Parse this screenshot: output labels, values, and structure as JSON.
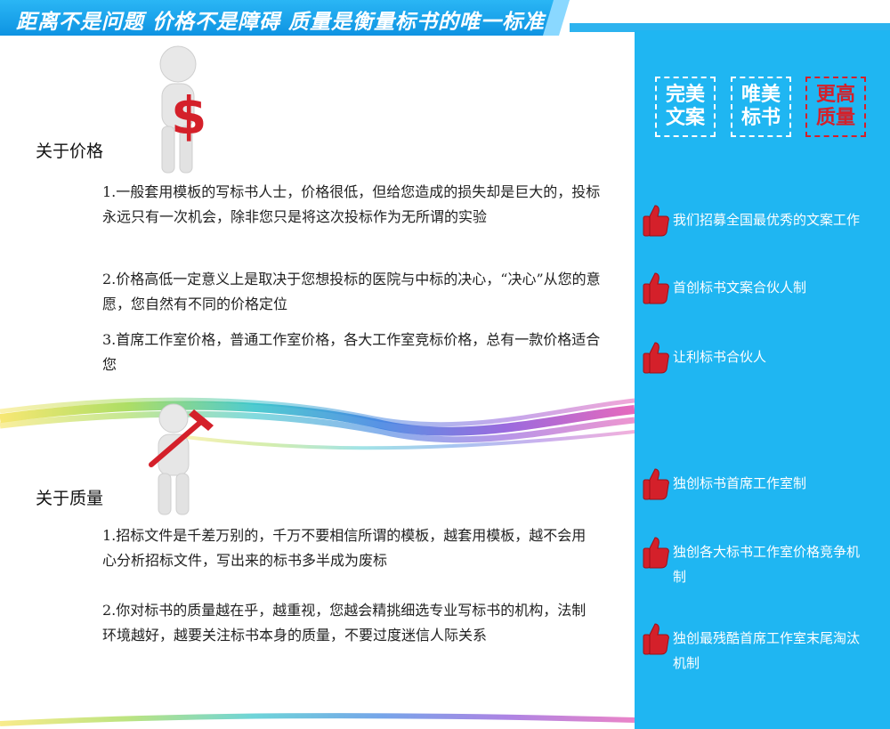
{
  "banner": {
    "title": "距离不是问题 价格不是障碍 质量是衡量标书的唯一标准"
  },
  "slogans": [
    {
      "text": "完美文案",
      "color": "#ffffff"
    },
    {
      "text": "唯美标书",
      "color": "#ffffff"
    },
    {
      "text": "更高质量",
      "color": "#d4202a"
    }
  ],
  "features": [
    {
      "text": "我们招募全国最优秀的文案工作"
    },
    {
      "text": "首创标书文案合伙人制"
    },
    {
      "text": "让利标书合伙人"
    },
    {
      "text": "独创标书首席工作室制"
    },
    {
      "text": "独创各大标书工作室价格竞争机制"
    },
    {
      "text": "独创最残酷首席工作室末尾淘汰机制"
    }
  ],
  "price": {
    "title": "关于价格",
    "items": [
      " 1.一般套用模板的写标书人士，价格很低，但给您造成的损失却是巨大的，投标永远只有一次机会，除非您只是将这次投标作为无所谓的实验",
      "2.价格高低一定意义上是取决于您想投标的医院与中标的决心，“决心”从您的意愿，您自然有不同的价格定位",
      "3.首席工作室价格，普通工作室价格，各大工作室竞标价格，总有一款价格适合您"
    ]
  },
  "quality": {
    "title": "关于质量",
    "items": [
      "1.招标文件是千差万别的，千万不要相信所谓的模板，越套用模板，越不会用心分析招标文件，写出来的标书多半成为废标",
      "2.你对标书的质量越在乎，越重视，您越会精挑细选专业写标书的机构，法制环境越好，越要关注标书本身的质量，不要过度迷信人际关系"
    ]
  },
  "colors": {
    "accent_blue": "#1fb6f2",
    "accent_red": "#d4202a"
  },
  "icons": [
    "thumbs-up-icon",
    "dollar-figure-icon",
    "hammer-figure-icon"
  ]
}
